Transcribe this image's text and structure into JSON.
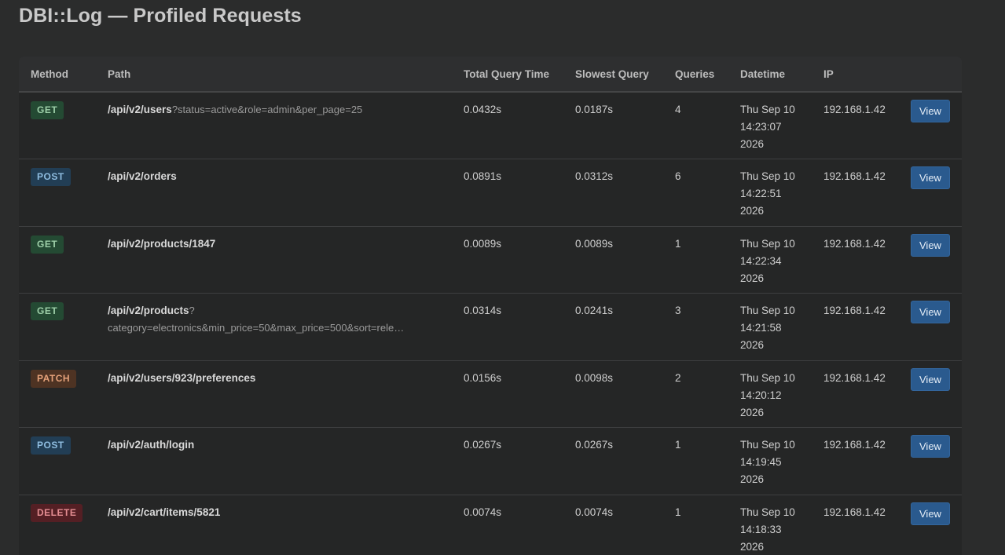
{
  "page_title": "DBI::Log — Profiled Requests",
  "columns": [
    "Method",
    "Path",
    "Total Query Time",
    "Slowest Query",
    "Queries",
    "Datetime",
    "IP",
    ""
  ],
  "view_label": "View",
  "rows": [
    {
      "method": "GET",
      "method_class": "m-get",
      "path_base": "/api/v2/users",
      "path_query": "?status=active&role=admin&per_page=25",
      "total": "0.0432s",
      "slowest": "0.0187s",
      "queries": "4",
      "datetime": "Thu Sep 10 14:23:07 2026",
      "ip": "192.168.1.42"
    },
    {
      "method": "POST",
      "method_class": "m-post",
      "path_base": "/api/v2/orders",
      "path_query": "",
      "total": "0.0891s",
      "slowest": "0.0312s",
      "queries": "6",
      "datetime": "Thu Sep 10 14:22:51 2026",
      "ip": "192.168.1.42"
    },
    {
      "method": "GET",
      "method_class": "m-get",
      "path_base": "/api/v2/products/1847",
      "path_query": "",
      "total": "0.0089s",
      "slowest": "0.0089s",
      "queries": "1",
      "datetime": "Thu Sep 10 14:22:34 2026",
      "ip": "192.168.1.42"
    },
    {
      "method": "GET",
      "method_class": "m-get",
      "path_base": "/api/v2/products",
      "path_query": "?",
      "path_query_line2": "category=electronics&min_price=50&max_price=500&sort=rele…",
      "total": "0.0314s",
      "slowest": "0.0241s",
      "queries": "3",
      "datetime": "Thu Sep 10 14:21:58 2026",
      "ip": "192.168.1.42"
    },
    {
      "method": "PATCH",
      "method_class": "m-patch",
      "path_base": "/api/v2/users/923/preferences",
      "path_query": "",
      "total": "0.0156s",
      "slowest": "0.0098s",
      "queries": "2",
      "datetime": "Thu Sep 10 14:20:12 2026",
      "ip": "192.168.1.42"
    },
    {
      "method": "POST",
      "method_class": "m-post",
      "path_base": "/api/v2/auth/login",
      "path_query": "",
      "total": "0.0267s",
      "slowest": "0.0267s",
      "queries": "1",
      "datetime": "Thu Sep 10 14:19:45 2026",
      "ip": "192.168.1.42"
    },
    {
      "method": "DELETE",
      "method_class": "m-delete",
      "path_base": "/api/v2/cart/items/5821",
      "path_query": "",
      "total": "0.0074s",
      "slowest": "0.0074s",
      "queries": "1",
      "datetime": "Thu Sep 10 14:18:33 2026",
      "ip": "192.168.1.42"
    }
  ]
}
